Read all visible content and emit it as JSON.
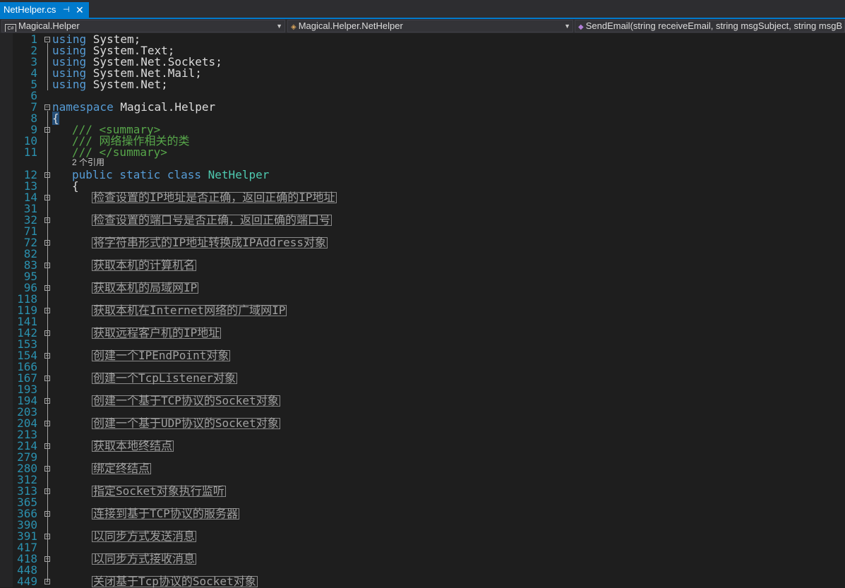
{
  "tab": {
    "title": "NetHelper.cs",
    "pin_glyph": "⊣",
    "close_glyph": "✕"
  },
  "nav": {
    "project": "Magical.Helper",
    "project_icon": "csharp-project-icon",
    "class": "Magical.Helper.NetHelper",
    "class_icon": "class-icon",
    "member": "SendEmail(string receiveEmail, string msgSubject, string msgB",
    "member_icon": "method-icon"
  },
  "lines": [
    {
      "n": "1",
      "text": "System;"
    },
    {
      "n": "2",
      "text": "System.Text;"
    },
    {
      "n": "3",
      "text": "System.Net.Sockets;"
    },
    {
      "n": "4",
      "text": "System.Net.Mail;"
    },
    {
      "n": "5",
      "text": "System.Net;"
    },
    {
      "n": "6",
      "text": ""
    },
    {
      "n": "7",
      "text": "Magical.Helper"
    },
    {
      "n": "8",
      "text": "{"
    },
    {
      "n": "9",
      "text": "/// <summary>"
    },
    {
      "n": "10",
      "text": "/// 网络操作相关的类"
    },
    {
      "n": "11",
      "text": "/// </summary>"
    },
    {
      "n": "12",
      "text": "NetHelper"
    },
    {
      "n": "13",
      "text": "{"
    }
  ],
  "keywords": {
    "using": "using",
    "namespace": "namespace",
    "public_static_class": "public static class"
  },
  "codelens": "2 个引用",
  "regions": [
    {
      "start": "14",
      "end": "31",
      "label": "检查设置的IP地址是否正确，返回正确的IP地址"
    },
    {
      "start": "32",
      "end": "71",
      "label": "检查设置的端口号是否正确，返回正确的端口号"
    },
    {
      "start": "72",
      "end": "82",
      "label": "将字符串形式的IP地址转换成IPAddress对象"
    },
    {
      "start": "83",
      "end": "95",
      "label": "获取本机的计算机名"
    },
    {
      "start": "96",
      "end": "118",
      "label": "获取本机的局域网IP"
    },
    {
      "start": "119",
      "end": "141",
      "label": "获取本机在Internet网络的广域网IP"
    },
    {
      "start": "142",
      "end": "153",
      "label": "获取远程客户机的IP地址"
    },
    {
      "start": "154",
      "end": "166",
      "label": "创建一个IPEndPoint对象"
    },
    {
      "start": "167",
      "end": "193",
      "label": "创建一个TcpListener对象"
    },
    {
      "start": "194",
      "end": "203",
      "label": "创建一个基于TCP协议的Socket对象"
    },
    {
      "start": "204",
      "end": "213",
      "label": "创建一个基于UDP协议的Socket对象"
    },
    {
      "start": "214",
      "end": "279",
      "label": "获取本地终结点"
    },
    {
      "start": "280",
      "end": "312",
      "label": "绑定终结点"
    },
    {
      "start": "313",
      "end": "365",
      "label": "指定Socket对象执行监听"
    },
    {
      "start": "366",
      "end": "390",
      "label": "连接到基于TCP协议的服务器"
    },
    {
      "start": "391",
      "end": "417",
      "label": "以同步方式发送消息"
    },
    {
      "start": "418",
      "end": "448",
      "label": "以同步方式接收消息"
    },
    {
      "start": "449",
      "end": "",
      "label": "关闭基于Tcp协议的Socket对象"
    }
  ],
  "colors": {
    "accent": "#007acc",
    "background": "#1e1e1e",
    "keyword": "#569cd6",
    "comment": "#57a64a",
    "type": "#4ec9b0",
    "line_number": "#2b91af"
  }
}
